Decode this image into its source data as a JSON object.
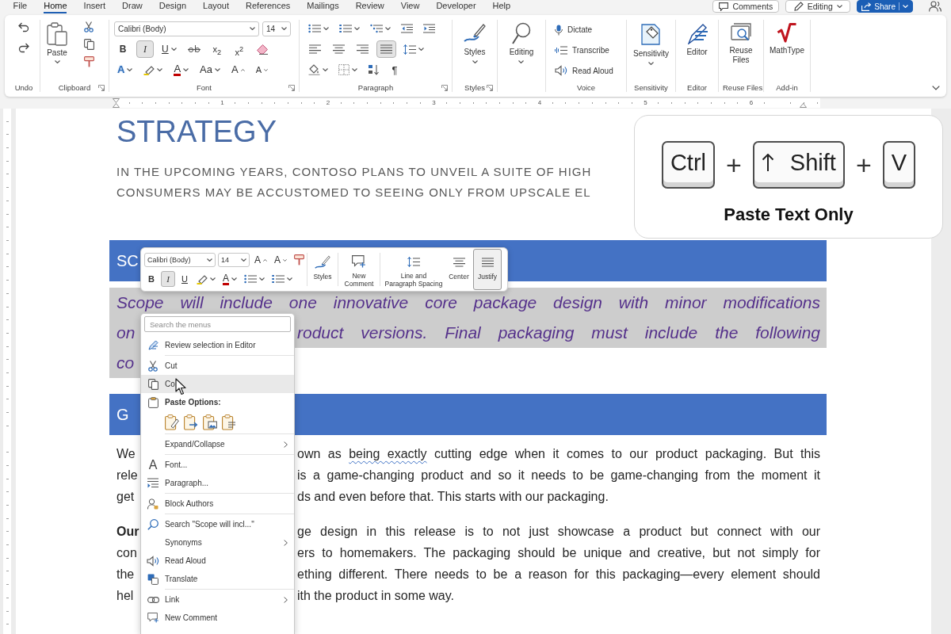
{
  "tabs": [
    {
      "label": "File",
      "selected": false
    },
    {
      "label": "Home",
      "selected": true
    },
    {
      "label": "Insert",
      "selected": false
    },
    {
      "label": "Draw",
      "selected": false
    },
    {
      "label": "Design",
      "selected": false
    },
    {
      "label": "Layout",
      "selected": false
    },
    {
      "label": "References",
      "selected": false
    },
    {
      "label": "Mailings",
      "selected": false
    },
    {
      "label": "Review",
      "selected": false
    },
    {
      "label": "View",
      "selected": false
    },
    {
      "label": "Developer",
      "selected": false
    },
    {
      "label": "Help",
      "selected": false
    }
  ],
  "header_buttons": [
    {
      "kind": "comments",
      "label": "Comments"
    },
    {
      "kind": "editing",
      "label": "Editing"
    },
    {
      "kind": "share",
      "label": "Share"
    }
  ],
  "ribbon": {
    "groups": [
      {
        "kind": "undo",
        "label": "Undo"
      },
      {
        "kind": "clipboard",
        "label": "Clipboard",
        "launcher": true,
        "paste_label": "Paste"
      },
      {
        "kind": "font",
        "label": "Font",
        "launcher": true,
        "font_name": "Calibri (Body)",
        "font_size": "14",
        "toggles": [
          {
            "kind": "bold",
            "text": "B",
            "selected": false
          },
          {
            "kind": "italic",
            "text": "I",
            "selected": true
          },
          {
            "kind": "underline",
            "text": "U",
            "selected": false
          }
        ],
        "subscript": "x$_{2}$",
        "superscript": "x$^{2}$",
        "effects": "A",
        "font_color": "A",
        "change_case": "Aa",
        "grow": "A",
        "shrink": "A"
      },
      {
        "kind": "paragraph",
        "label": "Paragraph",
        "launcher": true,
        "alignments": [
          {
            "kind": "left",
            "selected": false
          },
          {
            "kind": "center",
            "selected": false
          },
          {
            "kind": "right",
            "selected": false
          },
          {
            "kind": "justify",
            "selected": true
          }
        ],
        "pilcrow": "¶"
      },
      {
        "kind": "styles",
        "label": "Styles",
        "launcher": true,
        "button": "Styles"
      },
      {
        "kind": "editing",
        "button": "Editing"
      },
      {
        "kind": "voice",
        "label": "Voice",
        "items": [
          {
            "kind": "dictate",
            "label": "Dictate"
          },
          {
            "kind": "transcribe",
            "label": "Transcribe"
          },
          {
            "kind": "read_aloud",
            "label": "Read Aloud"
          }
        ]
      },
      {
        "kind": "sensitivity",
        "label": "Sensitivity",
        "button": "Sensitivity"
      },
      {
        "kind": "editor",
        "label": "Editor",
        "button": "Editor"
      },
      {
        "kind": "reuse",
        "label": "Reuse Files",
        "button": "Reuse Files"
      },
      {
        "kind": "addin",
        "label": "Add-in",
        "button": "MathType"
      }
    ]
  },
  "ruler": {
    "marks": [
      "1",
      "2",
      "3",
      "4",
      "5",
      "6"
    ]
  },
  "document": {
    "title": "STRATEGY",
    "intro": [
      "IN THE UPCOMING YEARS, CONTOSO PLANS TO UNVEIL A SUITE OF HIGH",
      "CONSUMERS MAY BE ACCUSTOMED TO SEEING ONLY FROM UPSCALE EL"
    ],
    "blocks": [
      {
        "kind": "heading",
        "text": "SC",
        "selected": false
      },
      {
        "kind": "emphasis",
        "selected": true,
        "lines": [
          {
            "left": "Scope will include one innovative core package design with minor modifications"
          },
          {
            "left": "on",
            "right": "roduct versions. Final packaging must include the following"
          },
          {
            "left": "co"
          }
        ]
      },
      {
        "kind": "heading",
        "text": "G",
        "selected": false
      },
      {
        "kind": "body",
        "selected": false,
        "lines": [
          {
            "left": "We",
            "segments": [
              {
                "text": "own as ",
                "flagged": false
              },
              {
                "text": "being exactly",
                "flagged": true
              },
              {
                "text": " cutting edge when it comes to our product packaging. But this",
                "flagged": false
              }
            ]
          },
          {
            "left": "rele",
            "right": "is a game-changing product and so it needs to be game-changing from the moment it"
          },
          {
            "left": "get",
            "right": "ds and even before that. This starts with our packaging."
          }
        ]
      },
      {
        "kind": "body",
        "selected": false,
        "lines": [
          {
            "left": "**Our**",
            "right": "ge design in this release is to not just showcase a product but connect with our"
          },
          {
            "left": "con",
            "right": "ers to homemakers. The packaging should be unique and creative, but not simply for"
          },
          {
            "left": "the",
            "right": "ething different. There needs to be a reason for this packaging—every element should"
          },
          {
            "left": "hel",
            "right": "ith the product in some way."
          }
        ]
      }
    ]
  },
  "mini_toolbar": {
    "font_name": "Calibri (Body)",
    "font_size": "14",
    "grow": "A",
    "shrink": "A",
    "toggles": [
      {
        "kind": "bold",
        "text": "B",
        "selected": false
      },
      {
        "kind": "italic",
        "text": "I",
        "selected": true
      },
      {
        "kind": "underline",
        "text": "U",
        "selected": false
      }
    ],
    "font_color": "A",
    "buttons": [
      {
        "kind": "styles",
        "label": "Styles",
        "selected": false
      },
      {
        "kind": "new_comment",
        "label": "New Comment",
        "selected": false
      },
      {
        "kind": "spacing",
        "label": "Line and Paragraph Spacing",
        "selected": false
      },
      {
        "kind": "center",
        "label": "Center",
        "selected": false
      },
      {
        "kind": "justify",
        "label": "Justify",
        "selected": true
      }
    ]
  },
  "context_menu": {
    "placeholder": "Search the menus",
    "items": [
      {
        "kind": "editor",
        "label": "Review selection in Editor",
        "submenu": false,
        "selected": false
      },
      {
        "kind": "separator"
      },
      {
        "kind": "cut",
        "label": "Cut",
        "submenu": false,
        "selected": false
      },
      {
        "kind": "copy",
        "label": "Co",
        "submenu": false,
        "selected": true
      },
      {
        "kind": "paste_header",
        "label": "Paste Options:",
        "submenu": false,
        "selected": false
      },
      {
        "kind": "paste_options",
        "options": [
          {
            "kind": "keep_source"
          },
          {
            "kind": "merge"
          },
          {
            "kind": "picture"
          },
          {
            "kind": "text_only"
          }
        ]
      },
      {
        "kind": "separator"
      },
      {
        "kind": "plain",
        "label": "Expand/Collapse",
        "submenu": true,
        "selected": false
      },
      {
        "kind": "separator"
      },
      {
        "kind": "font",
        "label": "Font...",
        "glyph": "A",
        "submenu": false,
        "selected": false
      },
      {
        "kind": "paragraph",
        "label": "Paragraph...",
        "submenu": false,
        "selected": false
      },
      {
        "kind": "separator"
      },
      {
        "kind": "block_authors",
        "label": "Block Authors",
        "submenu": false,
        "selected": false
      },
      {
        "kind": "separator"
      },
      {
        "kind": "search",
        "label": "Search \"Scope will incl...\"",
        "submenu": false,
        "selected": false
      },
      {
        "kind": "plain",
        "label": "Synonyms",
        "submenu": true,
        "selected": false
      },
      {
        "kind": "read_aloud",
        "label": "Read Aloud",
        "submenu": false,
        "selected": false
      },
      {
        "kind": "translate",
        "label": "Translate",
        "submenu": false,
        "selected": false
      },
      {
        "kind": "separator"
      },
      {
        "kind": "link",
        "label": "Link",
        "submenu": true,
        "selected": false
      },
      {
        "kind": "new_comment",
        "label": "New Comment",
        "submenu": false,
        "selected": false
      }
    ]
  },
  "shortcut_card": {
    "keys": [
      {
        "kind": "key",
        "label": "Ctrl",
        "arrow": false
      },
      {
        "kind": "plus",
        "label": "+"
      },
      {
        "kind": "key",
        "label": "Shift",
        "arrow": true
      },
      {
        "kind": "plus",
        "label": "+"
      },
      {
        "kind": "key",
        "label": "V",
        "arrow": false
      }
    ],
    "caption": "Paste Text Only"
  }
}
